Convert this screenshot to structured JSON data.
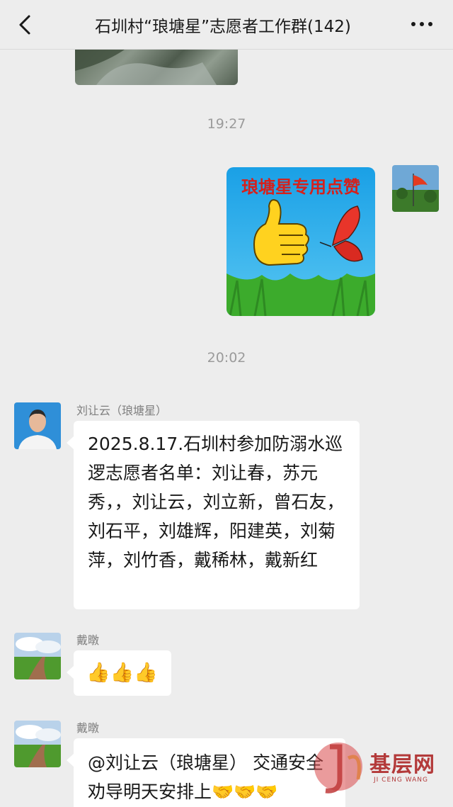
{
  "header": {
    "title": "石圳村“琅塘星”志愿者工作群(142)",
    "back_icon": "chevron-left-icon",
    "more_icon": "more-dots-icon"
  },
  "timestamps": [
    "19:27",
    "20:02"
  ],
  "sticker": {
    "caption": "琅塘星专用点赞"
  },
  "messages": [
    {
      "sender": "刘让云（琅塘星）",
      "text": "2025.8.17.石圳村参加防溺水巡逻志愿者名单：刘让春，苏元秀，，刘让云，刘立新，曾石友，刘石平，刘雄辉，阳建英，刘菊萍，刘竹香，戴稀林，戴新红"
    },
    {
      "sender": "戴暾",
      "text": "👍👍👍"
    },
    {
      "sender": "戴暾",
      "text": "@刘让云（琅塘星） 交通安全劝导明天安排上🤝🤝🤝"
    }
  ],
  "watermark": {
    "text": "基层网",
    "subtext": "JI CENG WANG"
  }
}
